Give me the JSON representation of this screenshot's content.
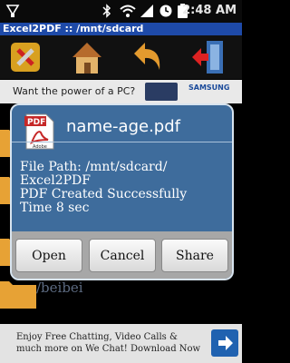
{
  "status_bar": {
    "time": "2:48 AM",
    "icons": [
      "usb-debug-icon",
      "bluetooth-icon",
      "wifi-icon",
      "signal-icon",
      "alarm-icon",
      "battery-icon"
    ]
  },
  "app": {
    "title": "Excel2PDF :: /mnt/sdcard"
  },
  "toolbar": {
    "buttons": [
      "settings-icon",
      "home-icon",
      "back-icon",
      "exit-icon"
    ]
  },
  "ad_top": {
    "text": "Want the power of a PC?",
    "brand": "SAMSUNG"
  },
  "file_list": {
    "items": [
      {
        "label": "/beibei"
      }
    ]
  },
  "dialog": {
    "title": "name-age.pdf",
    "file_path_line1": "File Path: /mnt/sdcard/",
    "file_path_line2": "Excel2PDF",
    "status": "PDF Created Successfully",
    "time": "Time 8 sec",
    "buttons": {
      "open": "Open",
      "cancel": "Cancel",
      "share": "Share"
    },
    "pdf_icon_label": "PDF",
    "pdf_icon_brand": "Adobe"
  },
  "ad_bottom": {
    "text": "Enjoy Free Chatting, Video Calls & much more on We Chat! Download Now"
  }
}
